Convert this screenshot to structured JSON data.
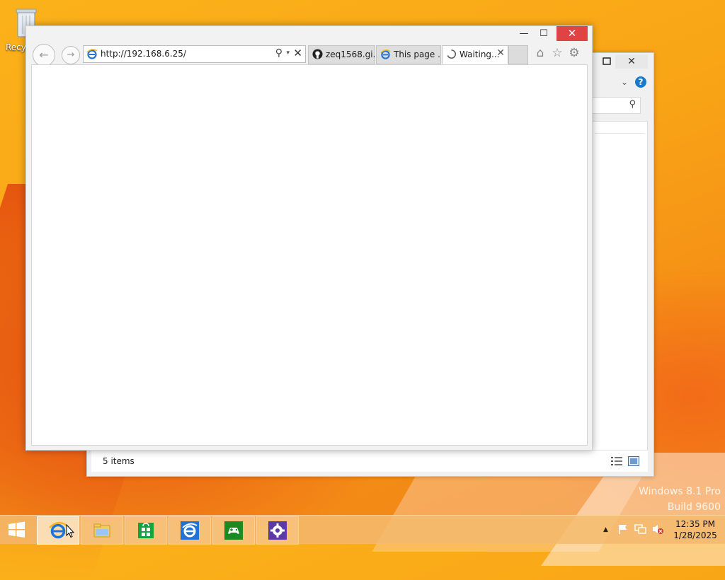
{
  "desktop": {
    "recycle_bin_label": "Recyc",
    "watermark": {
      "line1": "Windows 8.1 Pro",
      "line2": "Build 9600"
    }
  },
  "explorer": {
    "close_glyph": "✕",
    "help_glyph": "?",
    "chevron_glyph": "⌄",
    "search_glyph": "⚲",
    "status": {
      "item_count": "5 items"
    }
  },
  "browser": {
    "address": {
      "url": "http://192.168.6.25/"
    },
    "tabs": [
      {
        "label": "zeq1568.gi...",
        "icon": "github-icon"
      },
      {
        "label": "This page ...",
        "icon": "ie-icon"
      },
      {
        "label": "Waiting...",
        "icon": "loading-icon",
        "active": true
      }
    ],
    "window_buttons": {
      "minimize": "—",
      "maximize": "☐",
      "close": "✕"
    },
    "nav_glyphs": {
      "back": "←",
      "forward": "→",
      "stop": "✕",
      "dropdown": "▾",
      "search": "⚲",
      "tab_close": "✕",
      "home": "⌂",
      "favorites": "☆",
      "tools": "⚙"
    }
  },
  "taskbar": {
    "apps": [
      {
        "name": "internet-explorer",
        "active": true
      },
      {
        "name": "file-explorer",
        "active": false
      },
      {
        "name": "store",
        "active": false
      },
      {
        "name": "internet-explorer-metro",
        "active": false
      },
      {
        "name": "games",
        "active": false
      },
      {
        "name": "settings",
        "active": false
      }
    ],
    "tray": {
      "show_hidden_glyph": "▲"
    },
    "clock": {
      "time": "12:35 PM",
      "date": "1/28/2025"
    }
  },
  "colors": {
    "desktop_orange": "#f9a516",
    "close_red": "#e04343",
    "store_green": "#14a33c",
    "ie_blue": "#1e73d6",
    "games_green": "#1c8a22",
    "settings_purple": "#5b3aa8"
  }
}
